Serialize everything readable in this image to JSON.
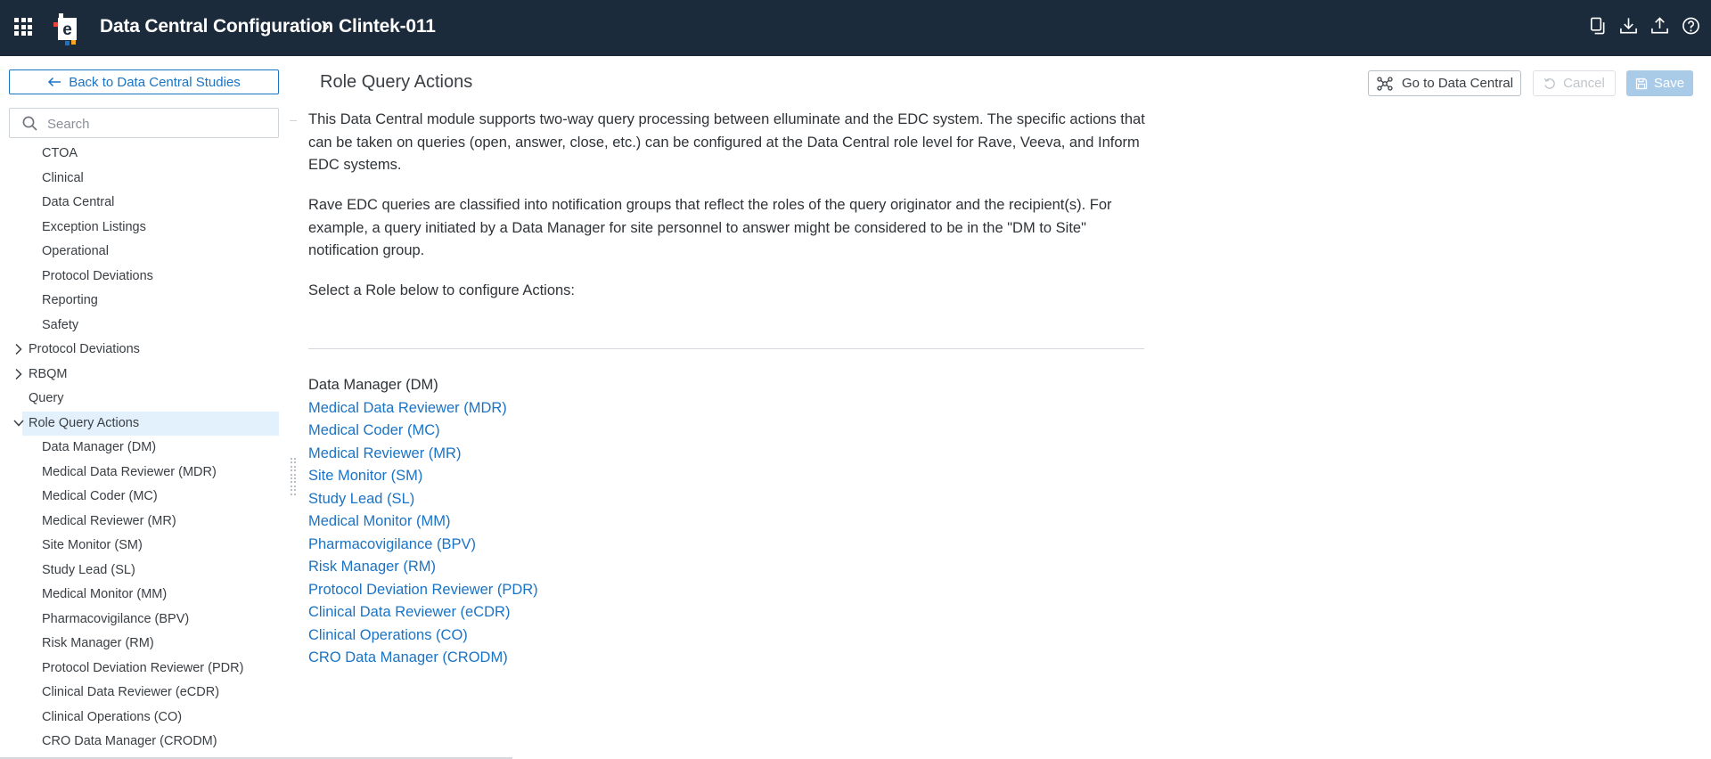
{
  "header": {
    "app_title": "Data Central Configuration",
    "study_title": "Clintek-011",
    "actions": [
      "copy-icon",
      "download-icon",
      "upload-icon",
      "help-icon"
    ],
    "colors": {
      "bar": "#1b2b3b",
      "logo_primary": "#1a73c5",
      "logo_accent_red": "#e8483b",
      "logo_accent_orange": "#f6a623"
    }
  },
  "sidebar": {
    "back_label": "Back to Data Central Studies",
    "search_placeholder": "Search",
    "tree": [
      {
        "label": "CTOA",
        "level": 2
      },
      {
        "label": "Clinical",
        "level": 2
      },
      {
        "label": "Data Central",
        "level": 2
      },
      {
        "label": "Exception Listings",
        "level": 2
      },
      {
        "label": "Operational",
        "level": 2
      },
      {
        "label": "Protocol Deviations",
        "level": 2
      },
      {
        "label": "Reporting",
        "level": 2
      },
      {
        "label": "Safety",
        "level": 2
      },
      {
        "label": "Protocol Deviations",
        "level": 1,
        "chevron": "right"
      },
      {
        "label": "RBQM",
        "level": 1,
        "chevron": "right"
      },
      {
        "label": "Query",
        "level": 1
      },
      {
        "label": "Role Query Actions",
        "level": 1,
        "chevron": "down",
        "selected": true
      },
      {
        "label": "Data Manager (DM)",
        "level": 2
      },
      {
        "label": "Medical Data Reviewer (MDR)",
        "level": 2
      },
      {
        "label": "Medical Coder (MC)",
        "level": 2
      },
      {
        "label": "Medical Reviewer (MR)",
        "level": 2
      },
      {
        "label": "Site Monitor (SM)",
        "level": 2
      },
      {
        "label": "Study Lead (SL)",
        "level": 2
      },
      {
        "label": "Medical Monitor (MM)",
        "level": 2
      },
      {
        "label": "Pharmacovigilance (BPV)",
        "level": 2
      },
      {
        "label": "Risk Manager (RM)",
        "level": 2
      },
      {
        "label": "Protocol Deviation Reviewer (PDR)",
        "level": 2
      },
      {
        "label": "Clinical Data Reviewer (eCDR)",
        "level": 2
      },
      {
        "label": "Clinical Operations (CO)",
        "level": 2
      },
      {
        "label": "CRO Data Manager (CRODM)",
        "level": 2
      }
    ]
  },
  "main": {
    "title": "Role Query Actions",
    "go_label": "Go to Data Central",
    "cancel_label": "Cancel",
    "save_label": "Save",
    "para1": "This Data Central module supports two-way query processing between elluminate and the EDC system. The specific actions that can be taken on queries (open, answer, close, etc.) can be configured at the Data Central role level for Rave, Veeva, and Inform EDC systems.",
    "para2": "Rave EDC queries are classified into notification groups that reflect the roles of the query originator and the recipient(s). For example, a query initiated by a Data Manager for site personnel to answer might be considered to be in the \"DM to Site\" notification group.",
    "para3": "Select a Role below to configure Actions:",
    "roles": [
      "Data Manager (DM)",
      "Medical Data Reviewer (MDR)",
      "Medical Coder (MC)",
      "Medical Reviewer (MR)",
      "Site Monitor (SM)",
      "Study Lead (SL)",
      "Medical Monitor (MM)",
      "Pharmacovigilance (BPV)",
      "Risk Manager (RM)",
      "Protocol Deviation Reviewer (PDR)",
      "Clinical Data Reviewer (eCDR)",
      "Clinical Operations (CO)",
      "CRO Data Manager (CRODM)"
    ],
    "current_role": "Data Manager (DM)",
    "colors": {
      "link": "#1a73c5",
      "selected_bg": "#e3f1fc",
      "save_disabled": "#a9cbe8"
    }
  }
}
